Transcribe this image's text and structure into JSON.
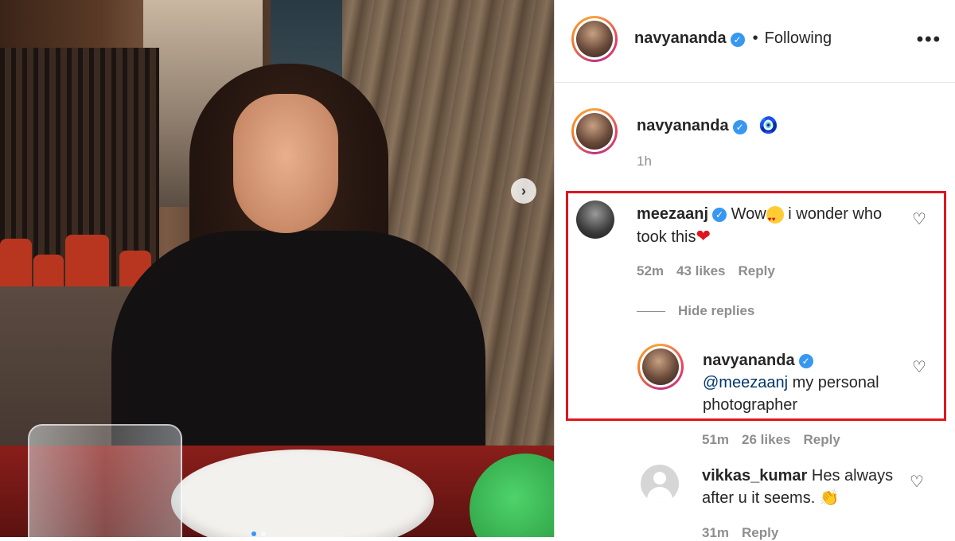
{
  "post": {
    "author": "navyananda",
    "follow_separator": "•",
    "follow_status": "Following",
    "more_icon": "•••",
    "caption_emoji": "🧿",
    "caption_time": "1h"
  },
  "comments": [
    {
      "user": "meezaanj",
      "text_before": "Wow",
      "text_after": " i wonder who took this",
      "time": "52m",
      "likes": "43 likes",
      "reply_label": "Reply",
      "hide_replies_label": "Hide replies"
    },
    {
      "user": "navyananda",
      "mention": "@meezaanj",
      "text": " my personal photographer",
      "time": "51m",
      "likes": "26 likes",
      "reply_label": "Reply"
    },
    {
      "user": "vikkas_kumar",
      "text": "Hes always after u it seems.",
      "time": "31m",
      "reply_label": "Reply"
    }
  ],
  "colors": {
    "verified": "#3897f0",
    "highlight_border": "#e0151e",
    "muted": "#8e8e8e"
  },
  "icons": [
    "verified-icon",
    "heart-outline-icon",
    "chevron-right-icon",
    "more-icon",
    "clap-emoji",
    "heart-eyes-emoji",
    "red-heart-emoji"
  ]
}
